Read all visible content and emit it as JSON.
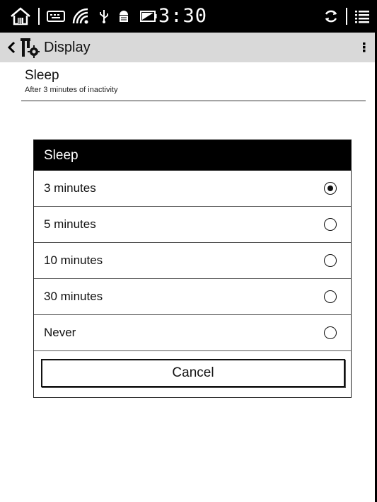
{
  "status_bar": {
    "time": "3:30",
    "icons": [
      "home-icon",
      "keyboard-icon",
      "wifi-icon",
      "usb-icon",
      "android-debug-icon",
      "battery-icon",
      "sync-icon",
      "menu-list-icon"
    ]
  },
  "action_bar": {
    "title": "Display",
    "back_icon": "chevron-left-icon",
    "app_icon": "settings-tools-icon",
    "overflow_icon": "overflow-menu-icon"
  },
  "preference": {
    "title": "Sleep",
    "summary": "After 3 minutes of inactivity"
  },
  "dialog": {
    "title": "Sleep",
    "options": [
      {
        "label": "3 minutes",
        "selected": true
      },
      {
        "label": "5 minutes",
        "selected": false
      },
      {
        "label": "10 minutes",
        "selected": false
      },
      {
        "label": "30 minutes",
        "selected": false
      },
      {
        "label": "Never",
        "selected": false
      }
    ],
    "cancel_label": "Cancel"
  }
}
